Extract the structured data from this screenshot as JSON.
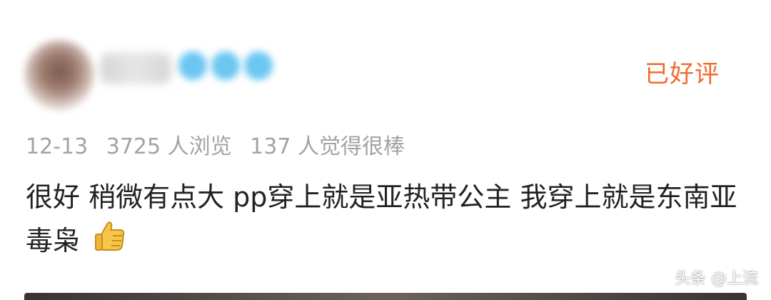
{
  "review": {
    "status": "已好评",
    "date": "12-13",
    "views": "3725 人浏览",
    "likes": "137 人觉得很棒",
    "text": "很好 稍微有点大 pp穿上就是亚热带公主 我穿上就是东南亚毒枭",
    "emoji": "thumbs-up-icon"
  },
  "watermark": "头条 @上流",
  "colors": {
    "status": "#f26a2e",
    "meta": "#a3a3a3",
    "text": "#222222",
    "badge": "#6bc6f2"
  }
}
